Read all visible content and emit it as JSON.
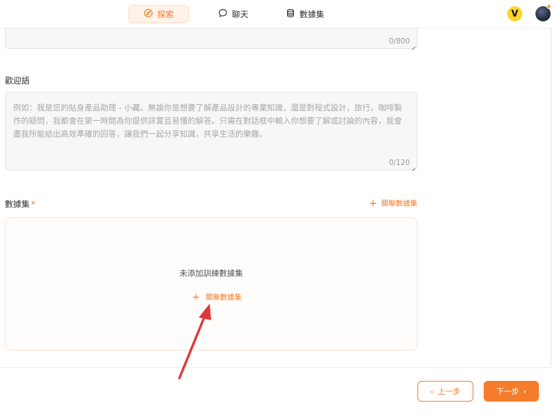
{
  "nav": {
    "tabs": [
      {
        "label": "探索",
        "icon": "compass-icon",
        "active": true
      },
      {
        "label": "聊天",
        "icon": "chat-bubble-icon",
        "active": false
      },
      {
        "label": "數據集",
        "icon": "database-icon",
        "active": false
      }
    ],
    "vip_badge": "V"
  },
  "top_textarea": {
    "counter": "0/800"
  },
  "welcome": {
    "label": "歡迎語",
    "placeholder": "例如：我是您的貼身產品助理 - 小藏。無論你是想要了解產品設計的專業知識，還是對程式設計，旅行，咖啡製作的疑問，我都會在第一時間為你提供詳實且易懂的解答。只需在對話框中輸入你想要了解或討論的內容，我會盡我所能給出高效準確的回答，讓我們一起分享知識，共享生活的樂趣。",
    "counter": "0/120"
  },
  "dataset": {
    "label": "數據集",
    "required_mark": "*",
    "associate_link": "關聯數據集",
    "empty_text": "未添加訓練數據集",
    "empty_link": "關聯數據集"
  },
  "footer": {
    "prev_label": "上一步",
    "prev_icon": "‹",
    "next_label": "下一步",
    "next_icon": "›"
  },
  "colors": {
    "accent": "#f47c2c",
    "vip": "#fcd52b",
    "annotation_arrow": "#e0383b"
  }
}
